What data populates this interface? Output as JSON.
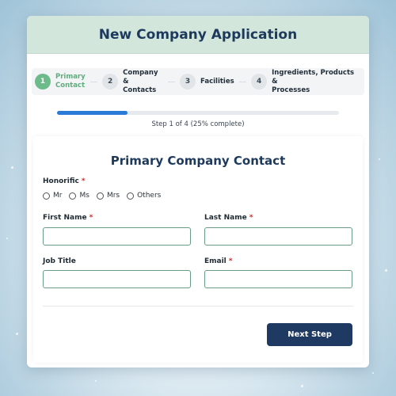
{
  "header": {
    "title": "New Company Application"
  },
  "steps": [
    {
      "number": "1",
      "label_line1": "Primary",
      "label_line2": "Contact"
    },
    {
      "number": "2",
      "label_line1": "Company &",
      "label_line2": "Contacts"
    },
    {
      "number": "3",
      "label_line1": "Facilities",
      "label_line2": ""
    },
    {
      "number": "4",
      "label_line1": "Ingredients, Products &",
      "label_line2": "Processes"
    }
  ],
  "progress": {
    "fraction": 0.25,
    "text": "Step 1 of 4 (25% complete)"
  },
  "section": {
    "title": "Primary Company Contact"
  },
  "honorific": {
    "label": "Honorific",
    "required_mark": "*",
    "options": [
      "Mr",
      "Ms",
      "Mrs",
      "Others"
    ]
  },
  "fields": {
    "first_name": {
      "label": "First Name",
      "required_mark": "*",
      "value": ""
    },
    "last_name": {
      "label": "Last Name",
      "required_mark": "*",
      "value": ""
    },
    "job_title": {
      "label": "Job Title",
      "required_mark": "",
      "value": ""
    },
    "email": {
      "label": "Email",
      "required_mark": "*",
      "value": ""
    }
  },
  "actions": {
    "next_label": "Next Step"
  },
  "colors": {
    "accent": "#2a7bd8",
    "active_step": "#6dbb8b",
    "primary_button": "#1e3a63",
    "header_bg": "#d3e6dc"
  }
}
